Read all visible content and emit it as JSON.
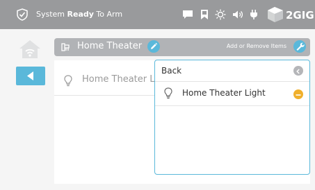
{
  "status_bar": {
    "status_prefix": "System ",
    "status_bold": "Ready",
    "status_suffix": " To Arm",
    "icons": [
      "shield-check-icon",
      "message-icon",
      "bookmark-icon",
      "sun-icon",
      "speaker-icon",
      "plug-icon"
    ],
    "brand": "2GIG"
  },
  "nav": {
    "home_icon": "home-wifi-icon",
    "back_icon": "back-arrow-icon"
  },
  "header": {
    "title": "Home Theater",
    "icon": "room-icon",
    "add_remove_label": "Add or Remove Items"
  },
  "list": {
    "items": [
      {
        "label": "Home Theater Li"
      }
    ]
  },
  "dropdown": {
    "back_label": "Back",
    "items": [
      {
        "label": "Home Theater Light",
        "action": "remove"
      }
    ]
  },
  "colors": {
    "topbar": "#999a9c",
    "accent": "#5ab8da",
    "remove": "#f0b02c",
    "header": "#b1b3b6"
  }
}
